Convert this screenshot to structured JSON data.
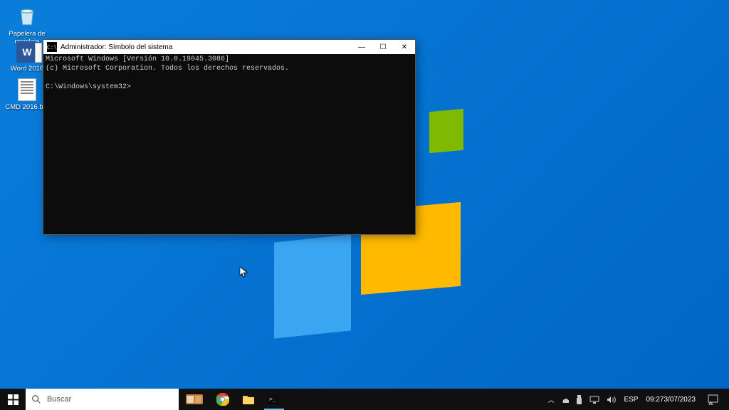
{
  "desktop": {
    "icons": [
      {
        "label": "Papelera de reciclaje"
      },
      {
        "label": "Word 2016"
      },
      {
        "label": "CMD 2016.bat"
      }
    ]
  },
  "cmd": {
    "title": "Administrador: Símbolo del sistema",
    "line1": "Microsoft Windows [Versión 10.0.19045.3086]",
    "line2": "(c) Microsoft Corporation. Todos los derechos reservados.",
    "prompt": "C:\\Windows\\system32>"
  },
  "taskbar": {
    "search_placeholder": "Buscar",
    "lang": "ESP",
    "time": "09:27",
    "date": "3/07/2023"
  },
  "winctrl": {
    "min": "—",
    "max": "☐",
    "close": "✕"
  }
}
